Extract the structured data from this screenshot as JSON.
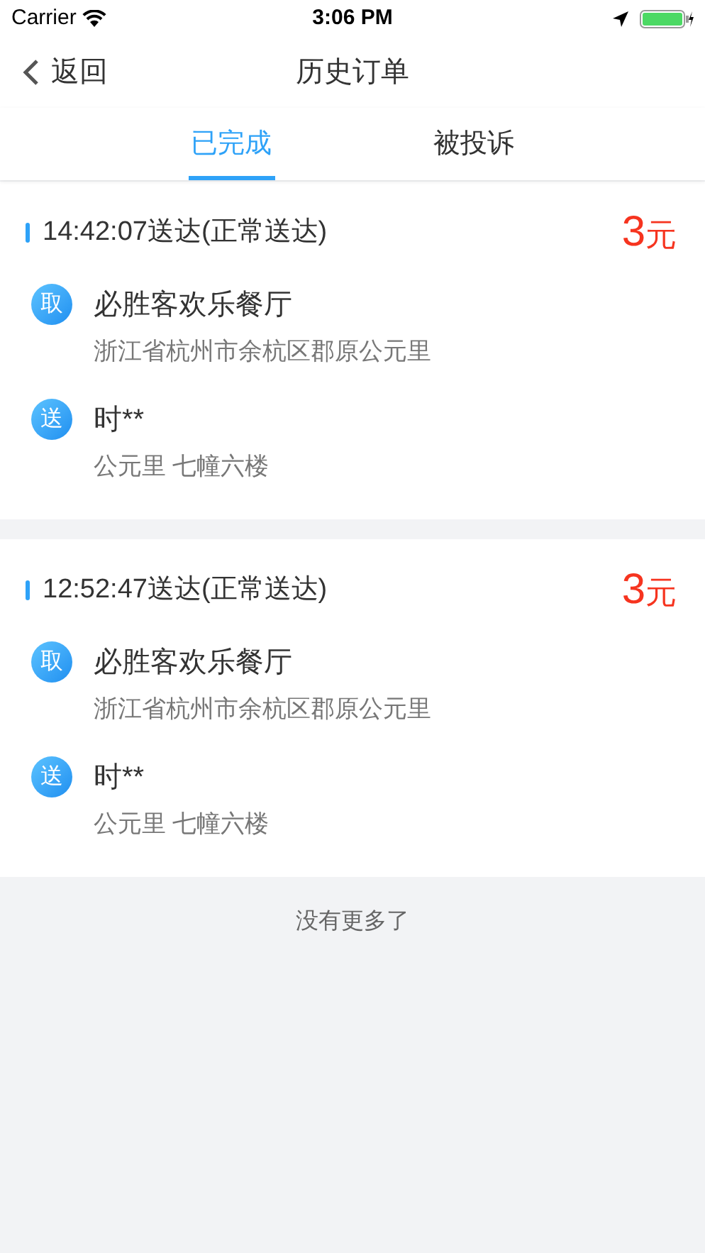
{
  "status_bar": {
    "carrier": "Carrier",
    "time": "3:06 PM"
  },
  "nav": {
    "back": "返回",
    "title": "历史订单"
  },
  "tabs": [
    {
      "label": "已完成",
      "selected": true
    },
    {
      "label": "被投诉",
      "selected": false
    }
  ],
  "orders": [
    {
      "time": "14:42:07送达(正常送达)",
      "amount": "3",
      "unit": "元",
      "stops": [
        {
          "badge": "取",
          "name": "必胜客欢乐餐厅",
          "address": "浙江省杭州市余杭区郡原公元里"
        },
        {
          "badge": "送",
          "name": "时**",
          "address": "公元里 七幢六楼"
        }
      ]
    },
    {
      "time": "12:52:47送达(正常送达)",
      "amount": "3",
      "unit": "元",
      "stops": [
        {
          "badge": "取",
          "name": "必胜客欢乐餐厅",
          "address": "浙江省杭州市余杭区郡原公元里"
        },
        {
          "badge": "送",
          "name": "时**",
          "address": "公元里 七幢六楼"
        }
      ]
    }
  ],
  "footer": "没有更多了"
}
